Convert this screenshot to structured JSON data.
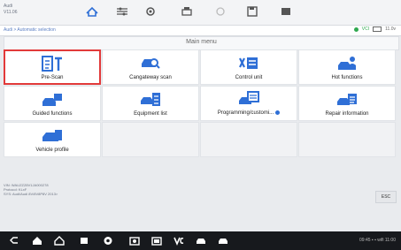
{
  "vehicle_info": {
    "make": "Audi",
    "model": "V11.06"
  },
  "breadcrumb": "Audi > Automatic selection",
  "status": {
    "vci": "VCI",
    "battery": "11.0v"
  },
  "main": {
    "title": "Main menu",
    "cells": [
      {
        "label": "Pre-Scan",
        "icon": "pre-scan-icon"
      },
      {
        "label": "Cangateway scan",
        "icon": "car-scan-icon"
      },
      {
        "label": "Control unit",
        "icon": "control-unit-icon"
      },
      {
        "label": "Hot functions",
        "icon": "hot-functions-icon"
      },
      {
        "label": "Guided functions",
        "icon": "guided-functions-icon"
      },
      {
        "label": "Equipment list",
        "icon": "equipment-list-icon"
      },
      {
        "label": "Programming/customi...",
        "icon": "programming-icon"
      },
      {
        "label": "Repair information",
        "icon": "repair-info-icon"
      },
      {
        "label": "Vehicle profile",
        "icon": "vehicle-profile-icon"
      }
    ]
  },
  "vehicle_line": {
    "line1": "VIN: WAUZZZ8V1JA000278",
    "line2": "Protocol: KLxF",
    "line3": "SYS: Audi/Audi 8V/8V8P8V 2013>"
  },
  "esc_label": "ESC",
  "bottom_status": "09:45 ▪ ▪ wifi 11:00"
}
